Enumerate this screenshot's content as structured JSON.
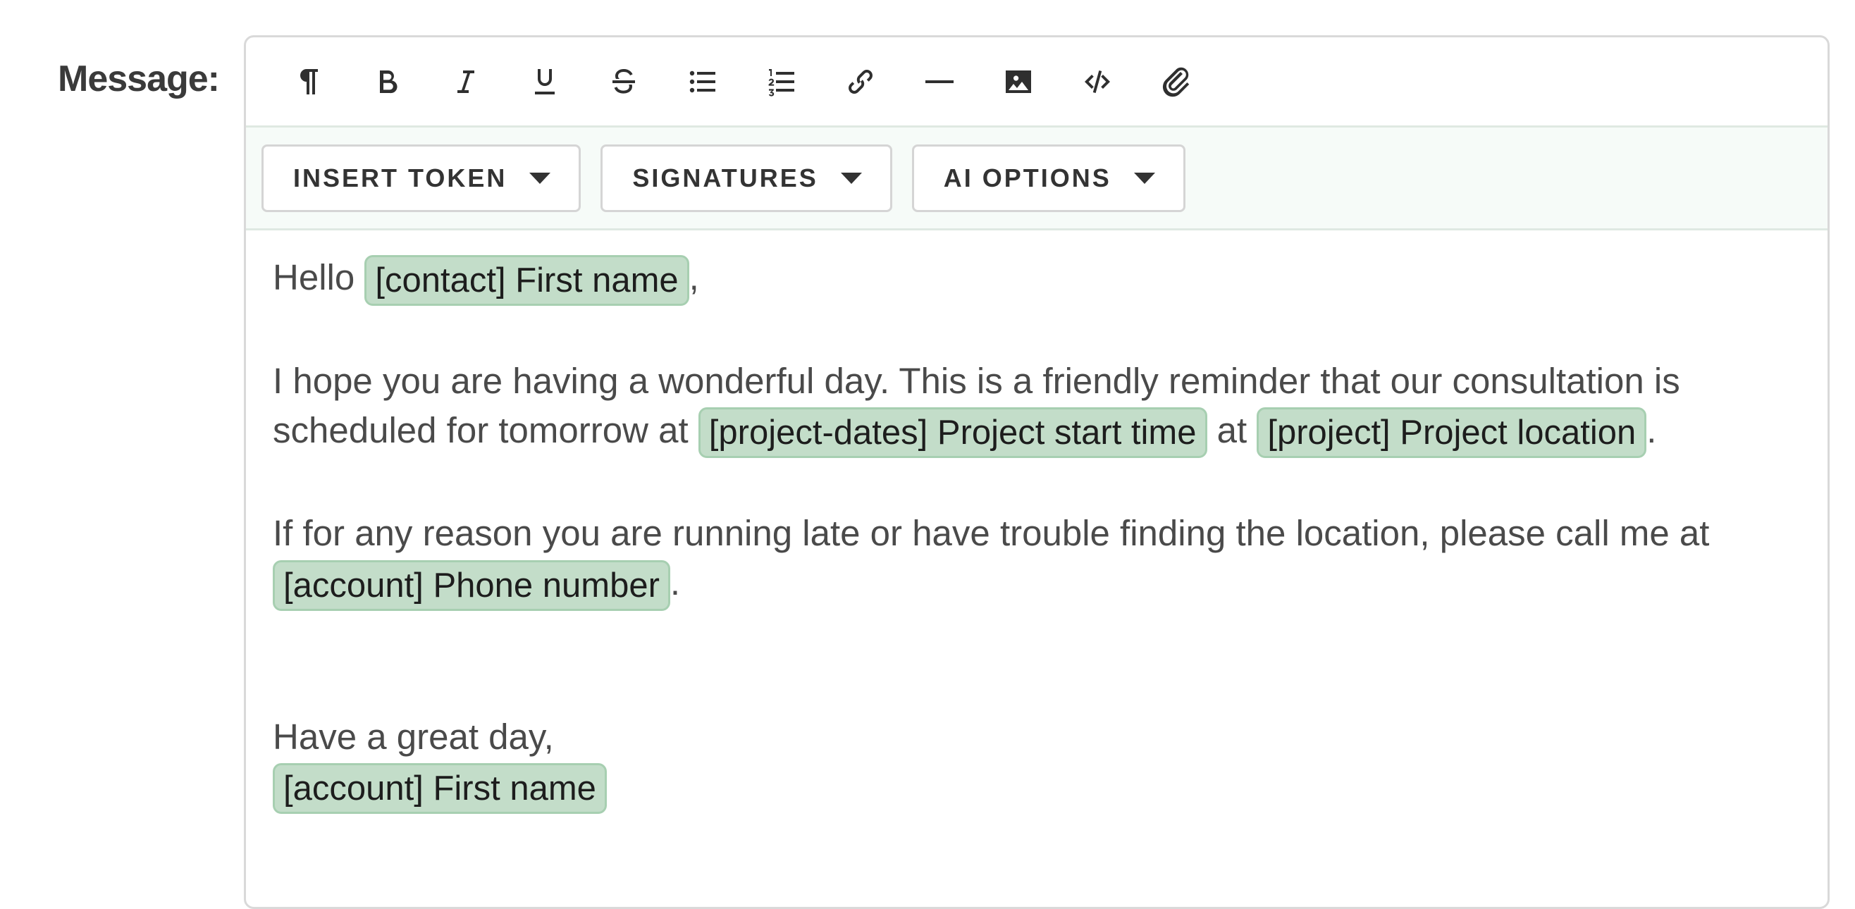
{
  "label": "Message:",
  "toolbar": {
    "icons": [
      "paragraph-icon",
      "bold-icon",
      "italic-icon",
      "underline-icon",
      "strikethrough-icon",
      "bullet-list-icon",
      "numbered-list-icon",
      "link-icon",
      "horizontal-rule-icon",
      "image-icon",
      "code-icon",
      "attachment-icon"
    ]
  },
  "actions": {
    "insert_token": "INSERT TOKEN",
    "signatures": "SIGNATURES",
    "ai_options": "AI OPTIONS"
  },
  "message": {
    "greeting": "Hello ",
    "greeting_token": "[contact] First name",
    "greeting_end": ",",
    "p1_text": "I hope you are having a wonderful day. This is a friendly reminder that our consultation is scheduled for tomorrow at ",
    "p1_token1": "[project-dates] Project start time",
    "p1_mid": " at ",
    "p1_token2": "[project] Project location",
    "p1_end": ".",
    "p2_text": "If for any reason you are running late or have trouble finding the location, please call me at ",
    "p2_token": "[account] Phone number",
    "p2_end": ".",
    "closing": "Have a great day,",
    "signature_token": "[account] First name"
  },
  "colors": {
    "token_bg": "#c3ddc9",
    "token_border": "#a7cfb1",
    "actions_bg": "#f6fbf8"
  }
}
